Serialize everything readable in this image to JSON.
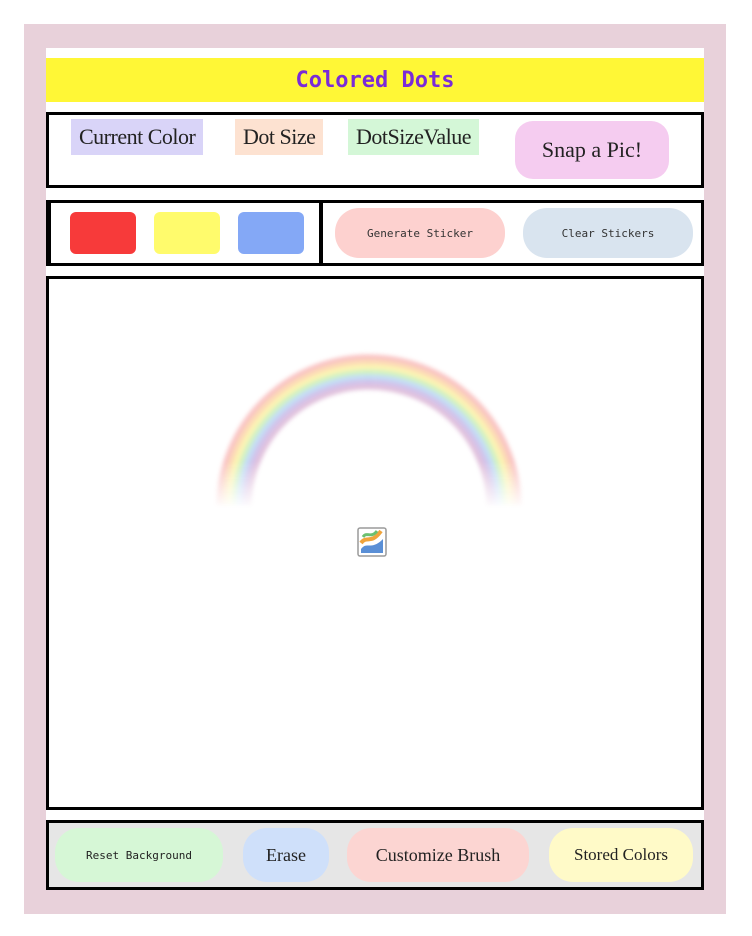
{
  "app": {
    "title": "Colored Dots"
  },
  "info": {
    "current_color_label": "Current Color",
    "dot_size_label": "Dot Size",
    "dot_size_value_label": "DotSizeValue",
    "snap_button": "Snap a Pic!"
  },
  "palette": {
    "colors": [
      "#f73a3a",
      "#fffb6c",
      "#84a8f6"
    ],
    "color_names": [
      "red",
      "yellow",
      "blue"
    ]
  },
  "stickers": {
    "generate_button": "Generate Sticker",
    "clear_button": "Clear Stickers"
  },
  "canvas": {
    "sticker": "rainbow",
    "broken_image_icon": "image-icon"
  },
  "toolbar": {
    "reset_background": "Reset Background",
    "erase": "Erase",
    "customize_brush": "Customize Brush",
    "stored_colors": "Stored Colors"
  },
  "colors": {
    "frame": "#e8d1da",
    "title_bg": "#fff736",
    "title_text": "#7a2bd8",
    "snap_bg": "#f5ccf0",
    "generate_bg": "#fdd1cf",
    "clear_bg": "#d9e4ef",
    "reset_bg": "#d6f7d6",
    "erase_bg": "#cfe0fa",
    "customize_bg": "#fcd5d2",
    "stored_bg": "#fffac8",
    "bottom_bar_bg": "#e6e6e6"
  }
}
